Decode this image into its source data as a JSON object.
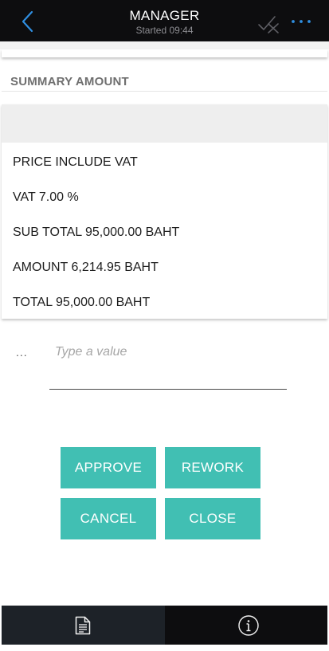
{
  "header": {
    "title": "MANAGER",
    "subtitle": "Started 09:44",
    "back_icon": "chevron-left-icon",
    "check_icon": "checkmark-disabled-icon",
    "more_icon": "more-horizontal-icon"
  },
  "section": {
    "title": "SUMMARY AMOUNT"
  },
  "summary": {
    "rows": [
      "PRICE INCLUDE VAT",
      "VAT 7.00 %",
      "SUB TOTAL 95,000.00 BAHT",
      "AMOUNT 6,214.95 BAHT",
      "TOTAL 95,000.00 BAHT"
    ]
  },
  "input": {
    "prefix": "...",
    "placeholder": "Type a value",
    "value": ""
  },
  "actions": {
    "approve": "APPROVE",
    "rework": "REWORK",
    "cancel": "CANCEL",
    "close": "CLOSE"
  },
  "tabs": {
    "document_icon": "document-icon",
    "info_icon": "info-icon"
  },
  "colors": {
    "accent": "#41bfb3",
    "back_icon": "#2f8ee0",
    "bar_background": "#0d0d0f",
    "active_tab": "#1d2228"
  }
}
